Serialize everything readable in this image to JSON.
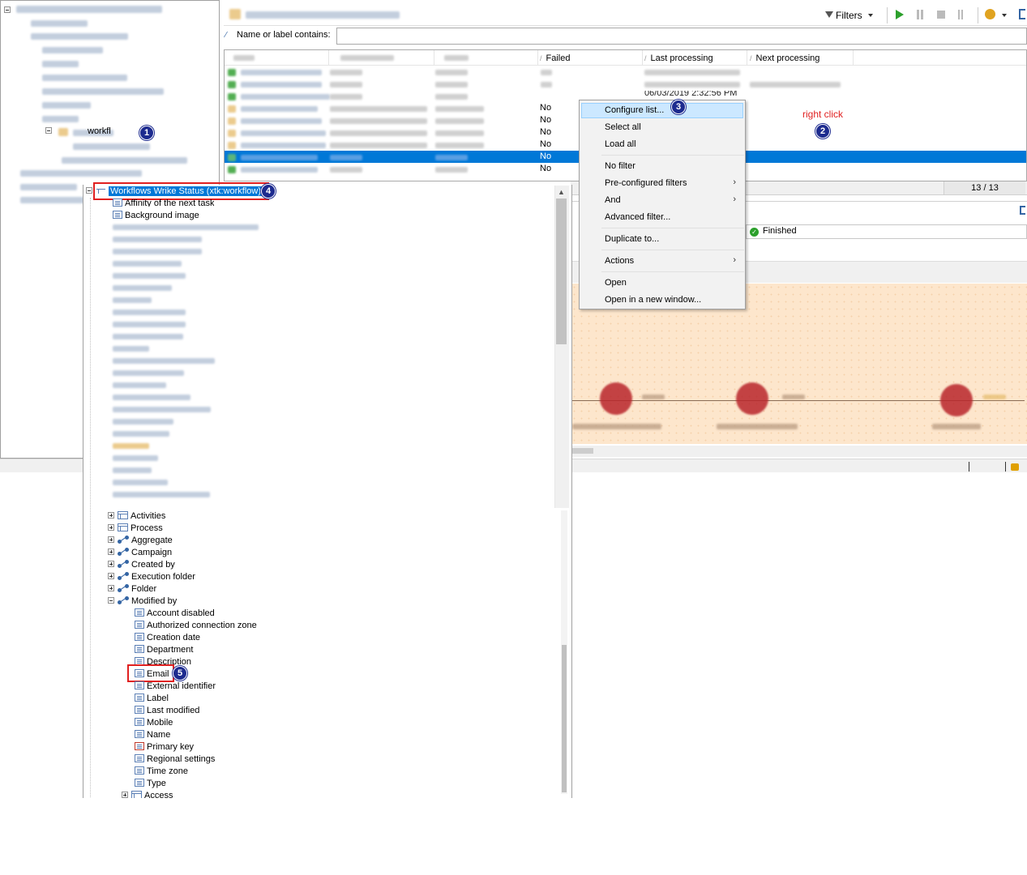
{
  "toolbar": {
    "filters_label": "Filters"
  },
  "search": {
    "label": "Name or label contains:",
    "value": ""
  },
  "columns": {
    "failed": "Failed",
    "last_processing": "Last processing",
    "next_processing": "Next processing"
  },
  "failed_values": [
    "No",
    "No",
    "No",
    "No",
    "No",
    "No"
  ],
  "partial_date": "06/03/2019 2:32:56 PM",
  "pagination": "13 / 13",
  "status_value": "Finished",
  "left_tree": {
    "selected_partial": "workfl"
  },
  "context_menu": {
    "items": {
      "configure_list": "Configure list...",
      "select_all": "Select all",
      "load_all": "Load all",
      "no_filter": "No filter",
      "preconfigured_filters": "Pre-configured filters",
      "and": "And",
      "advanced_filter": "Advanced filter...",
      "duplicate_to": "Duplicate to...",
      "actions": "Actions",
      "open": "Open",
      "open_new_window": "Open in a new window..."
    }
  },
  "annotation": {
    "right_click": "right click"
  },
  "steps": [
    "1",
    "2",
    "3",
    "4",
    "5"
  ],
  "field_tree": {
    "root": "Workflows Wrike Status (xtk:workflow)",
    "top_fields": [
      "Affinity of the next task",
      "Background image"
    ],
    "groups": [
      "Activities",
      "Process"
    ],
    "links": [
      "Aggregate",
      "Campaign",
      "Created by",
      "Execution folder",
      "Folder",
      "Modified by"
    ],
    "modified_by_children": [
      "Account disabled",
      "Authorized connection zone",
      "Creation date",
      "Department",
      "Description",
      "Email",
      "External identifier",
      "Label",
      "Last modified",
      "Mobile",
      "Name",
      "Primary key",
      "Regional settings",
      "Time zone",
      "Type"
    ],
    "access": "Access"
  },
  "colors": {
    "selection": "#0078d7",
    "menu_highlight": "#cce8ff",
    "annotation_red": "#e02020",
    "badge": "#1d2b8f",
    "diagram_bg": "#fde6cc"
  }
}
